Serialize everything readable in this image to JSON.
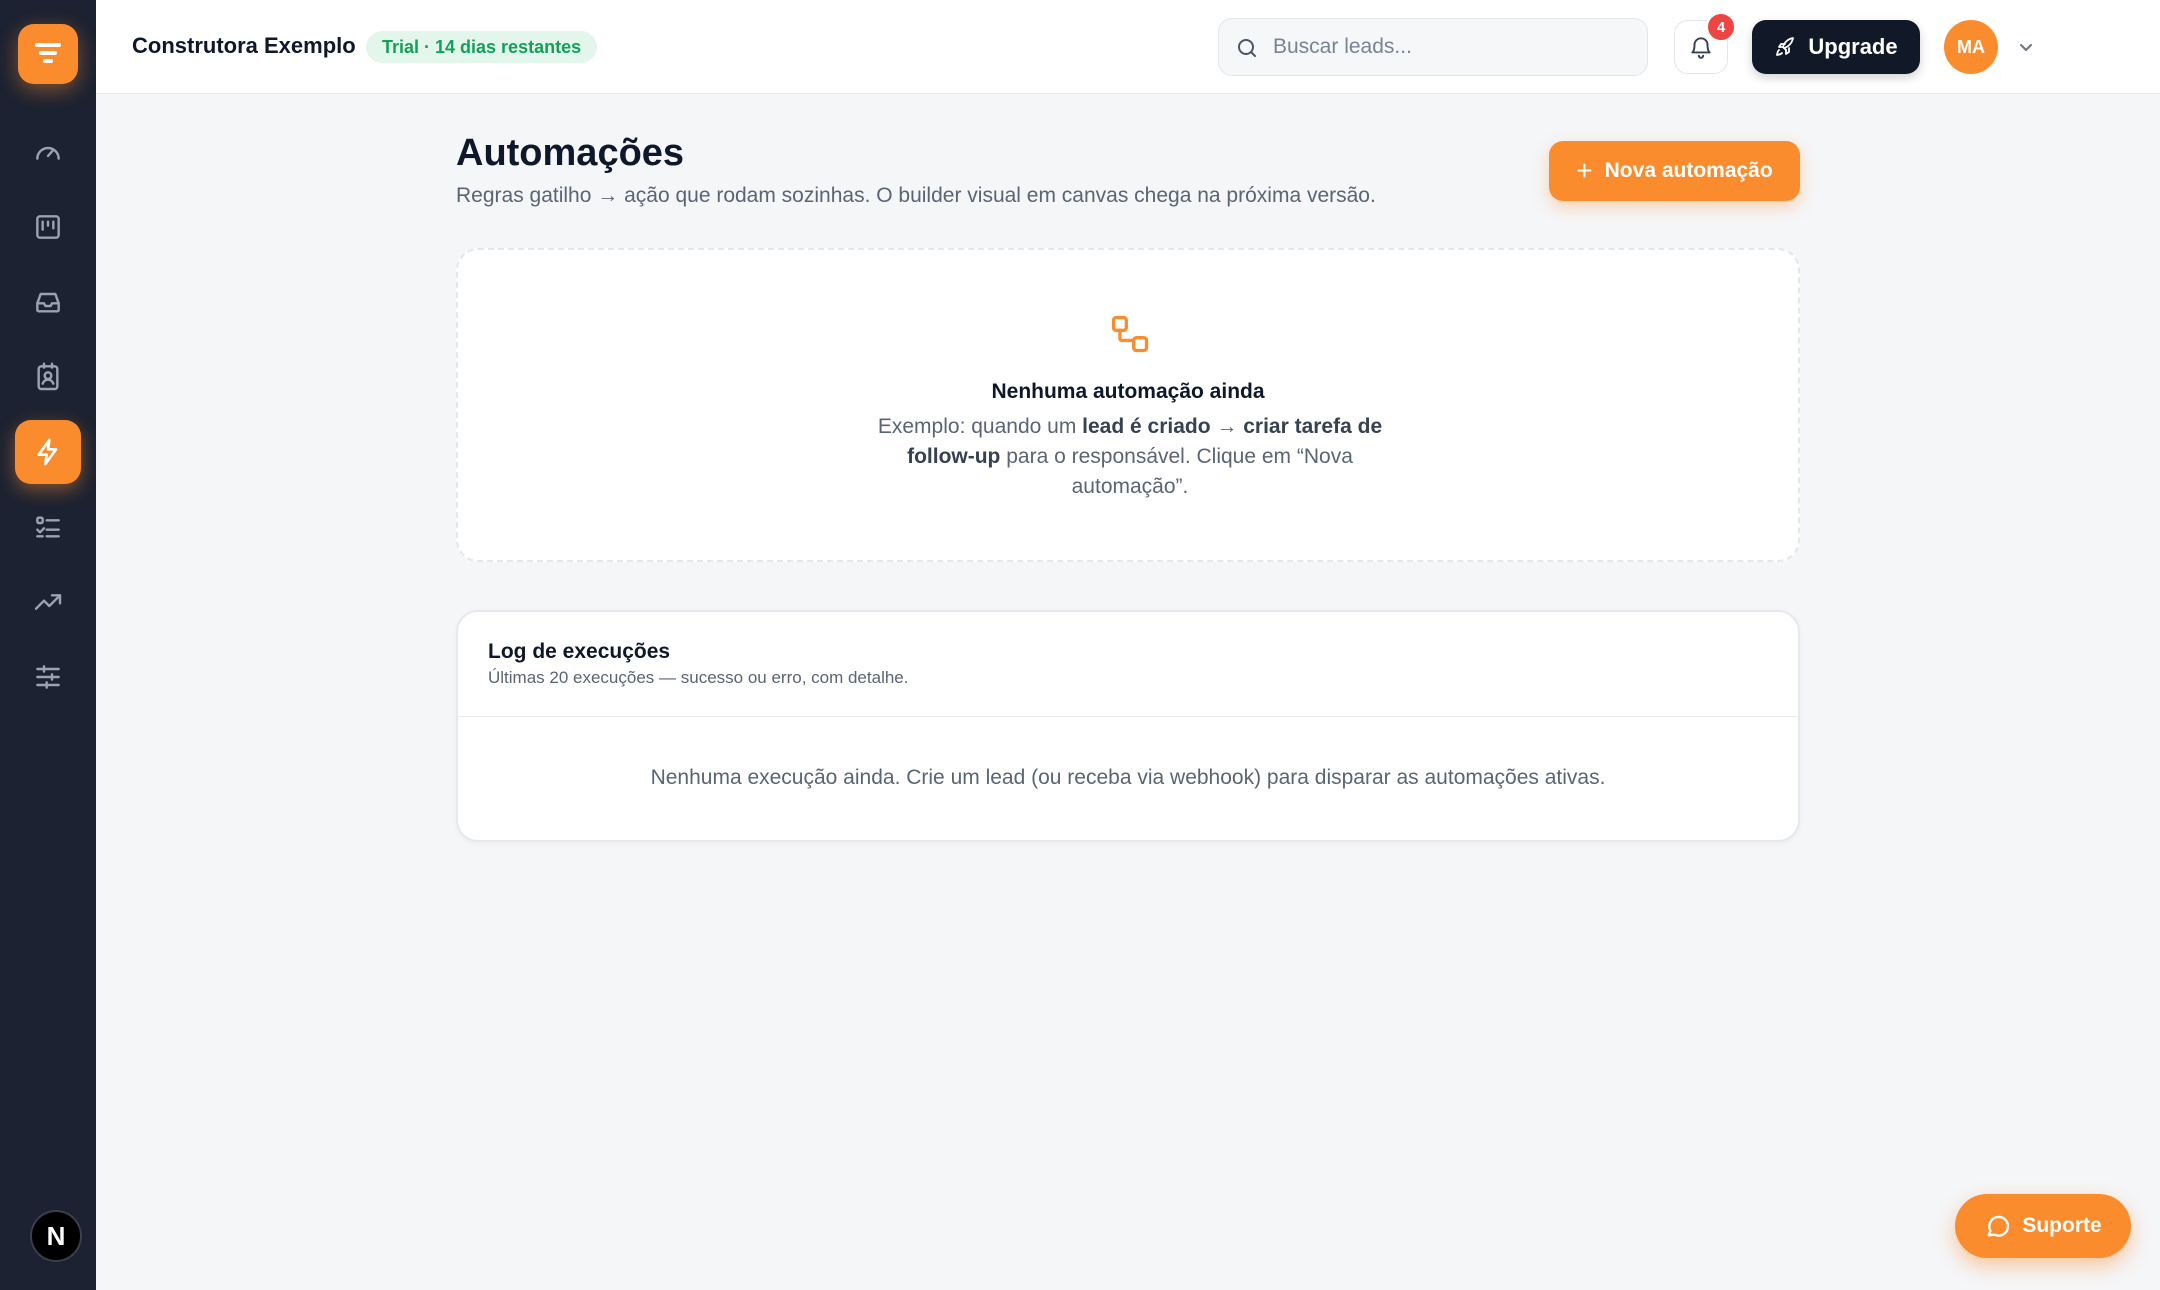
{
  "header": {
    "org_name": "Construtora Exemplo",
    "trial_label": "Trial · 14 dias restantes",
    "search_placeholder": "Buscar leads...",
    "notification_count": "4",
    "upgrade_label": "Upgrade",
    "avatar_initials": "MA"
  },
  "sidebar": {
    "items": [
      {
        "name": "dashboard",
        "icon": "gauge-icon"
      },
      {
        "name": "kanban",
        "icon": "kanban-icon"
      },
      {
        "name": "inbox",
        "icon": "inbox-icon"
      },
      {
        "name": "contacts",
        "icon": "contact-card-icon"
      },
      {
        "name": "automations",
        "icon": "bolt-icon",
        "active": true
      },
      {
        "name": "tasks",
        "icon": "list-checks-icon"
      },
      {
        "name": "reports",
        "icon": "trending-up-icon"
      },
      {
        "name": "settings",
        "icon": "sliders-icon"
      }
    ],
    "footer_badge": "N"
  },
  "main": {
    "title": "Automações",
    "subtitle": "Regras gatilho → ação que rodam sozinhas. O builder visual em canvas chega na próxima versão.",
    "new_button_label": "Nova automação",
    "empty": {
      "title": "Nenhuma automação ainda",
      "text_1": "Exemplo: quando um ",
      "text_bold_1": "lead é criado",
      "text_2": " → ",
      "text_bold_2": "criar tarefa de follow-up",
      "text_3": " para o responsável. Clique em “Nova automação”."
    },
    "log": {
      "title": "Log de execuções",
      "subtitle": "Últimas 20 execuções — sucesso ou erro, com detalhe.",
      "empty_text": "Nenhuma execução ainda. Crie um lead (ou receba via webhook) para disparar as automações ativas."
    }
  },
  "support_label": "Suporte",
  "colors": {
    "accent": "#fb8c2e",
    "sidebar_bg": "#1c2231",
    "trial_text": "#14a05a",
    "trial_bg": "#e3f6ec",
    "badge_red": "#ef4444",
    "upgrade_bg": "#111827"
  }
}
